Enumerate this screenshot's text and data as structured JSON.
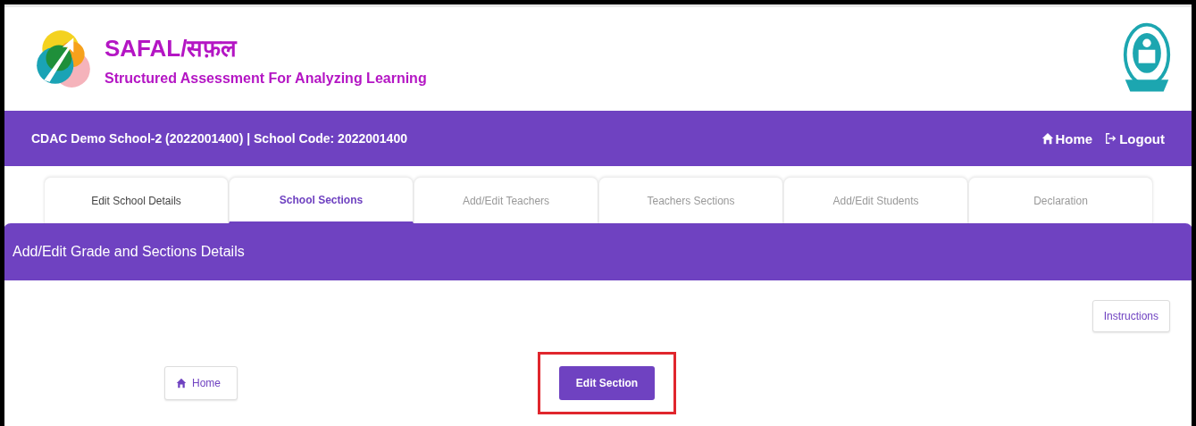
{
  "brand": {
    "title": "SAFAL/सफ़ल",
    "subtitle": "Structured Assessment For Analyzing Learning"
  },
  "navbar": {
    "school": "CDAC Demo School-2 (2022001400) | School Code: 2022001400",
    "links": [
      {
        "kind": "home",
        "label": "Home"
      },
      {
        "kind": "logout",
        "label": "Logout"
      }
    ]
  },
  "tabs": [
    {
      "label": "Edit School Details",
      "selected": false,
      "disabled": false
    },
    {
      "label": "School Sections",
      "selected": true,
      "disabled": false
    },
    {
      "label": "Add/Edit Teachers",
      "selected": false,
      "disabled": true
    },
    {
      "label": "Teachers Sections",
      "selected": false,
      "disabled": true
    },
    {
      "label": "Add/Edit Students",
      "selected": false,
      "disabled": true
    },
    {
      "label": "Declaration",
      "selected": false,
      "disabled": true
    }
  ],
  "panel": {
    "title": "Add/Edit Grade and Sections Details",
    "instructions_button": "Instructions",
    "home_button": "Home",
    "edit_button": {
      "label": "Edit Section",
      "highlighted": true
    }
  }
}
